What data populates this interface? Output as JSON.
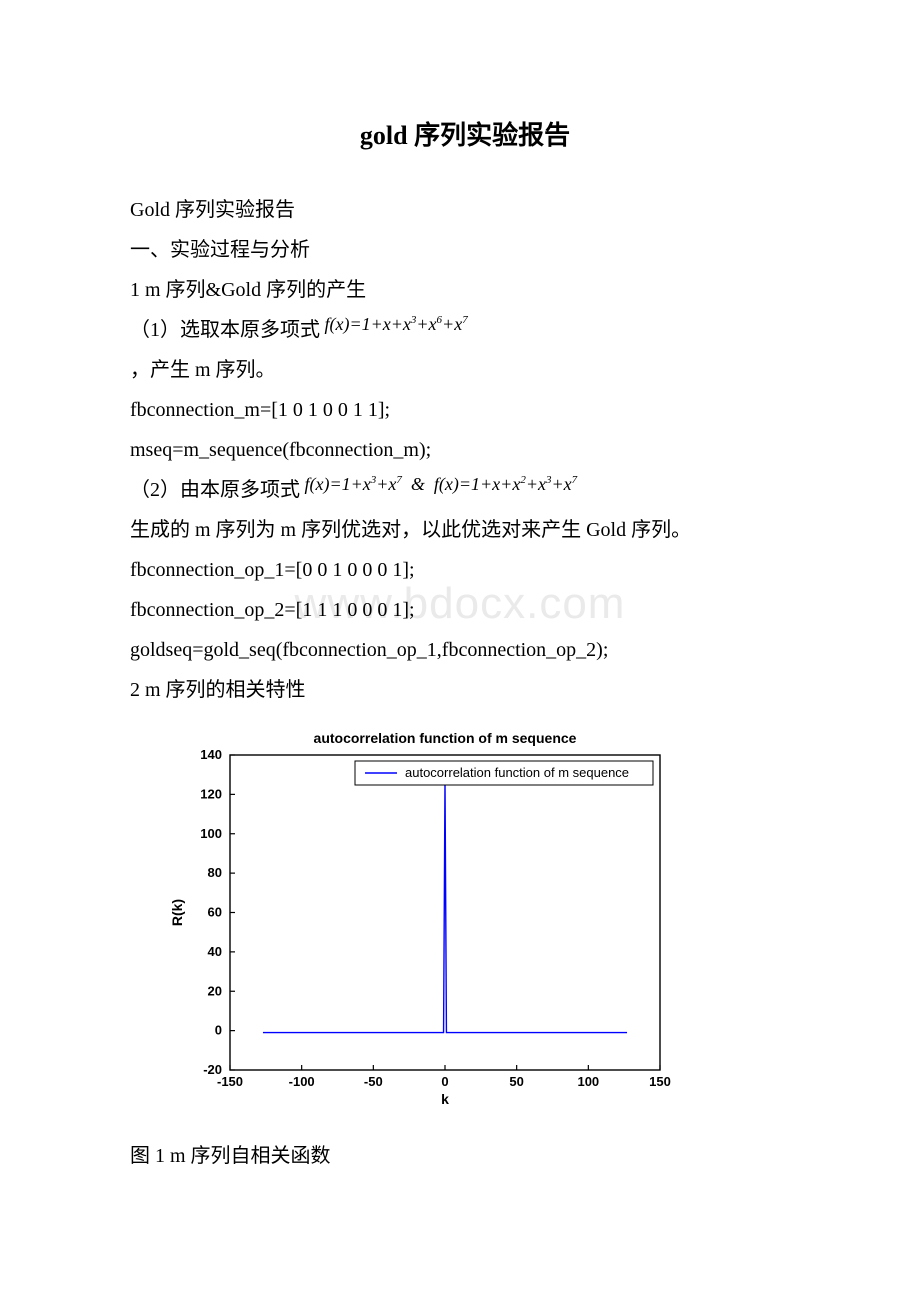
{
  "title": "gold 序列实验报告",
  "watermark": "www.bdocx.com",
  "lines": {
    "l1": "Gold 序列实验报告",
    "l2": "一、实验过程与分析",
    "l3": "1 m 序列&Gold 序列的产生",
    "l4a": "（1）选取本原多项式",
    "l4b_formula": "f(x)=1+x+x³+x⁶+x⁷",
    "l5": "，产生 m 序列。",
    "l6": "fbconnection_m=[1 0 1 0 0 1 1];",
    "l7": "mseq=m_sequence(fbconnection_m);",
    "l8a": "（2）由本原多项式",
    "l8b_formula": "f(x)=1+x³+x⁷  &  f(x)=1+x+x²+x³+x⁷",
    "l9": "生成的 m 序列为 m 序列优选对，以此优选对来产生 Gold 序列。",
    "l10": "fbconnection_op_1=[0 0 1 0 0 0 1];",
    "l11": "fbconnection_op_2=[1 1 1 0 0 0 1];",
    "l12": "goldseq=gold_seq(fbconnection_op_1,fbconnection_op_2);",
    "l13": "2 m 序列的相关特性",
    "caption": "图 1 m 序列自相关函数"
  },
  "chart_data": {
    "type": "line",
    "title": "autocorrelation function of m sequence",
    "xlabel": "k",
    "ylabel": "R(k)",
    "xlim": [
      -150,
      150
    ],
    "ylim": [
      -20,
      140
    ],
    "xticks": [
      -150,
      -100,
      -50,
      0,
      50,
      100,
      150
    ],
    "yticks": [
      -20,
      0,
      20,
      40,
      60,
      80,
      100,
      120,
      140
    ],
    "legend": {
      "position": "top-right-inside",
      "items": [
        "autocorrelation function of m sequence"
      ]
    },
    "series": [
      {
        "name": "autocorrelation function of m sequence",
        "color": "#0000ff",
        "description": "flat near -1 across k range with a single narrow spike to 127 at k=0",
        "points": [
          {
            "x": -127,
            "y": -1
          },
          {
            "x": -1,
            "y": -1
          },
          {
            "x": 0,
            "y": 127
          },
          {
            "x": 1,
            "y": -1
          },
          {
            "x": 127,
            "y": -1
          }
        ]
      }
    ]
  }
}
